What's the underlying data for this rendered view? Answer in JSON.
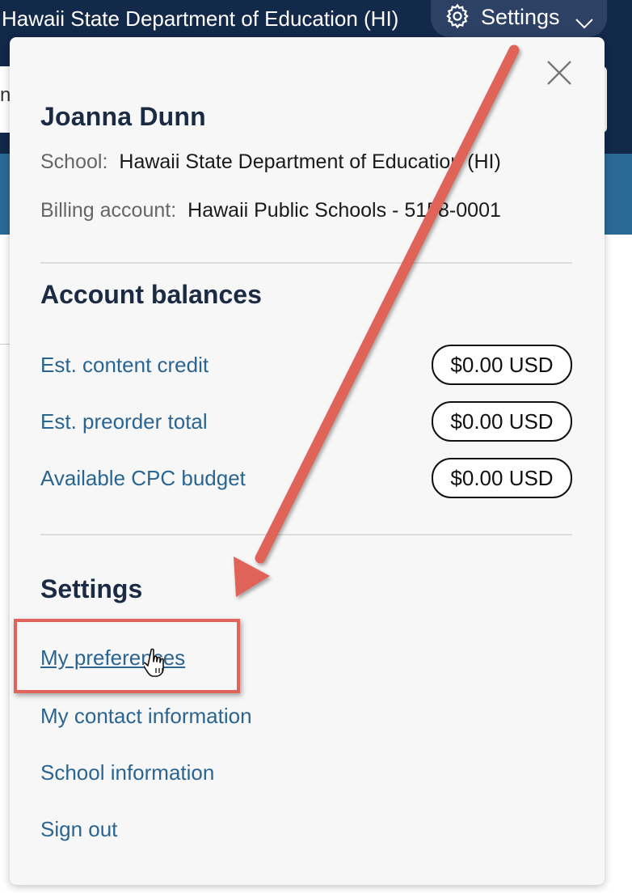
{
  "header": {
    "school_name": "Hawaii State Department of Education (HI)",
    "settings_label": "Settings",
    "search_partial": "n"
  },
  "popover": {
    "user_name": "Joanna Dunn",
    "school_label": "School:",
    "school_value": "Hawaii State Department of Education (HI)",
    "billing_label": "Billing account:",
    "billing_value": "Hawaii Public Schools - 5158-0001",
    "balances_heading": "Account balances",
    "balances": [
      {
        "label": "Est. content credit",
        "value": "$0.00 USD"
      },
      {
        "label": "Est. preorder total",
        "value": "$0.00 USD"
      },
      {
        "label": "Available CPC budget",
        "value": "$0.00 USD"
      }
    ],
    "settings_heading": "Settings",
    "settings_links": [
      {
        "label": "My preferences"
      },
      {
        "label": "My contact information"
      },
      {
        "label": "School information"
      },
      {
        "label": "Sign out"
      }
    ]
  },
  "icons": {
    "gear": "gear-icon",
    "chevron": "chevron-down-icon",
    "close": "close-icon",
    "cursor": "hand-pointer-icon"
  },
  "colors": {
    "navy": "#13294a",
    "link": "#2a6592",
    "annotation": "#e0645a"
  }
}
